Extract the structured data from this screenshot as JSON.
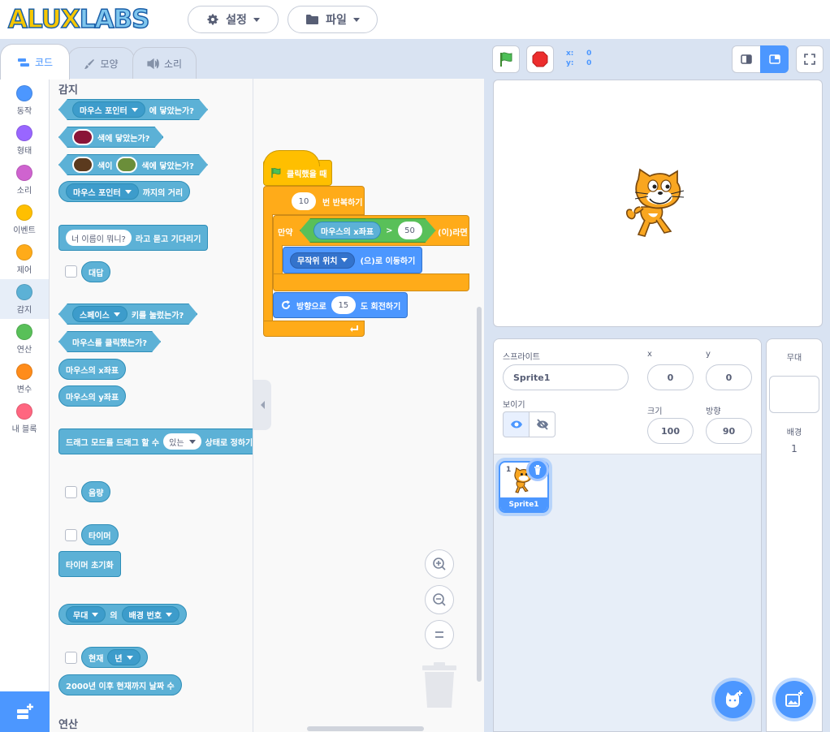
{
  "header": {
    "logo_part1": "ALUX",
    "logo_part2": "LABS",
    "settings_label": "설정",
    "file_label": "파일"
  },
  "tabs": {
    "code": "코드",
    "costume": "모양",
    "sound": "소리"
  },
  "categories": [
    {
      "label": "동작",
      "color": "#4c97ff"
    },
    {
      "label": "형태",
      "color": "#9966ff"
    },
    {
      "label": "소리",
      "color": "#cf63cf"
    },
    {
      "label": "이벤트",
      "color": "#ffbf00"
    },
    {
      "label": "제어",
      "color": "#ffab19"
    },
    {
      "label": "감지",
      "color": "#5cb1d6"
    },
    {
      "label": "연산",
      "color": "#59c059"
    },
    {
      "label": "변수",
      "color": "#ff8c1a"
    },
    {
      "label": "내 블록",
      "color": "#ff6680"
    }
  ],
  "palette": {
    "section_sensing": "감지",
    "touching_target": "마우스 포인터",
    "touching_suffix": "에 닿았는가?",
    "touching_color_suffix": "색에 닿았는가?",
    "color_touching_mid": "색이",
    "color_touching_suffix": "색에 닿았는가?",
    "distance_target": "마우스 포인터",
    "distance_suffix": "까지의 거리",
    "ask_input": "너 이름이 뭐니?",
    "ask_suffix": "라고 묻고 기다리기",
    "answer": "대답",
    "key_name": "스페이스",
    "key_suffix": "키를 눌렀는가?",
    "mouse_down": "마우스를 클릭했는가?",
    "mouse_x": "마우스의 x좌표",
    "mouse_y": "마우스의 y좌표",
    "drag_prefix": "드래그 모드를 드래그 할 수",
    "drag_option": "있는",
    "drag_suffix": "상태로 정하기",
    "loudness": "음량",
    "timer": "타이머",
    "reset_timer": "타이머 초기화",
    "of_target": "무대",
    "of_mid": "의",
    "of_property": "배경 번호",
    "current": "현재",
    "current_option": "년",
    "days_since": "2000년 이후 현재까지 날짜 수",
    "section_operators": "연산",
    "swatch_colors": [
      "#8a1538",
      "#5b3a1e",
      "#6b8e3a"
    ]
  },
  "script": {
    "when_flag": "클릭했을 때",
    "repeat_count": "10",
    "repeat_label": "번 반복하기",
    "if_label": "만약",
    "if_then": "(이)라면",
    "cond_left": "마우스의 x좌표",
    "cond_op": ">",
    "cond_right": "50",
    "goto_target": "무작위 위치",
    "goto_suffix": "(으)로 이동하기",
    "turn_prefix": "방향으로",
    "turn_degrees": "15",
    "turn_suffix": "도 회전하기"
  },
  "stage_controls": {
    "x_label": "x:",
    "x_value": "0",
    "y_label": "y:",
    "y_value": "0"
  },
  "sprite_info": {
    "sprite_label": "스프라이트",
    "sprite_name": "Sprite1",
    "x_label": "x",
    "x_value": "0",
    "y_label": "y",
    "y_value": "0",
    "show_label": "보이기",
    "size_label": "크기",
    "size_value": "100",
    "direction_label": "방향",
    "direction_value": "90"
  },
  "sprite_list": [
    {
      "index": "1",
      "name": "Sprite1"
    }
  ],
  "stage_panel": {
    "title": "무대",
    "backdrops_label": "배경",
    "backdrops_count": "1"
  }
}
